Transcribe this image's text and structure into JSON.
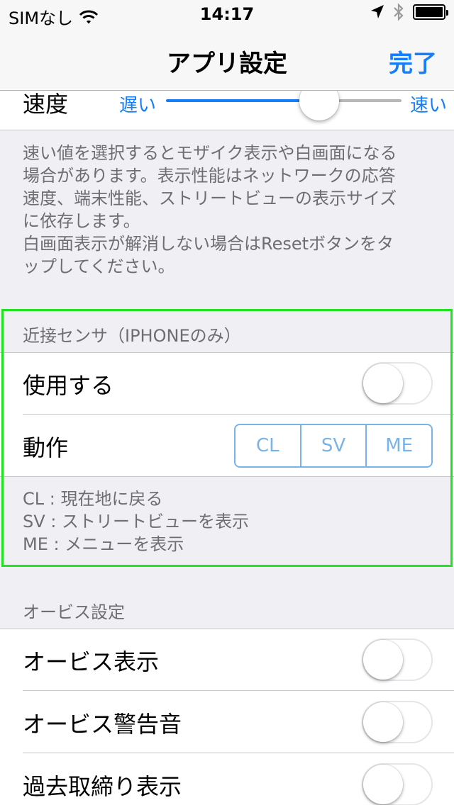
{
  "status_bar": {
    "carrier": "SIMなし",
    "time": "14:17"
  },
  "nav": {
    "title": "アプリ設定",
    "done_label": "完了"
  },
  "speed": {
    "label": "速度",
    "min_label": "遅い",
    "max_label": "速い",
    "value": 0.66
  },
  "speed_note": [
    "速い値を選択するとモザイク表示や白画面になる",
    "場合があります。表示性能はネットワークの応答",
    "速度、端末性能、ストリートビューの表示サイズ",
    "に依存します。",
    "白画面表示が解消しない場合はResetボタンをタ",
    "ップしてください。"
  ],
  "proximity": {
    "header": "近接センサ（IPHONEのみ）",
    "use_label": "使用する",
    "use_on": false,
    "action_label": "動作",
    "segments": [
      "CL",
      "SV",
      "ME"
    ],
    "notes": [
      "CL : 現在地に戻る",
      "SV : ストリートビューを表示",
      "ME : メニューを表示"
    ]
  },
  "orbis": {
    "header": "オービス設定",
    "items": [
      {
        "label": "オービス表示",
        "on": false
      },
      {
        "label": "オービス警告音",
        "on": false
      },
      {
        "label": "過去取締り表示",
        "on": false
      }
    ]
  },
  "colors": {
    "accent": "#147efb",
    "segment": "#7ab3e8",
    "highlight": "#22e322"
  }
}
